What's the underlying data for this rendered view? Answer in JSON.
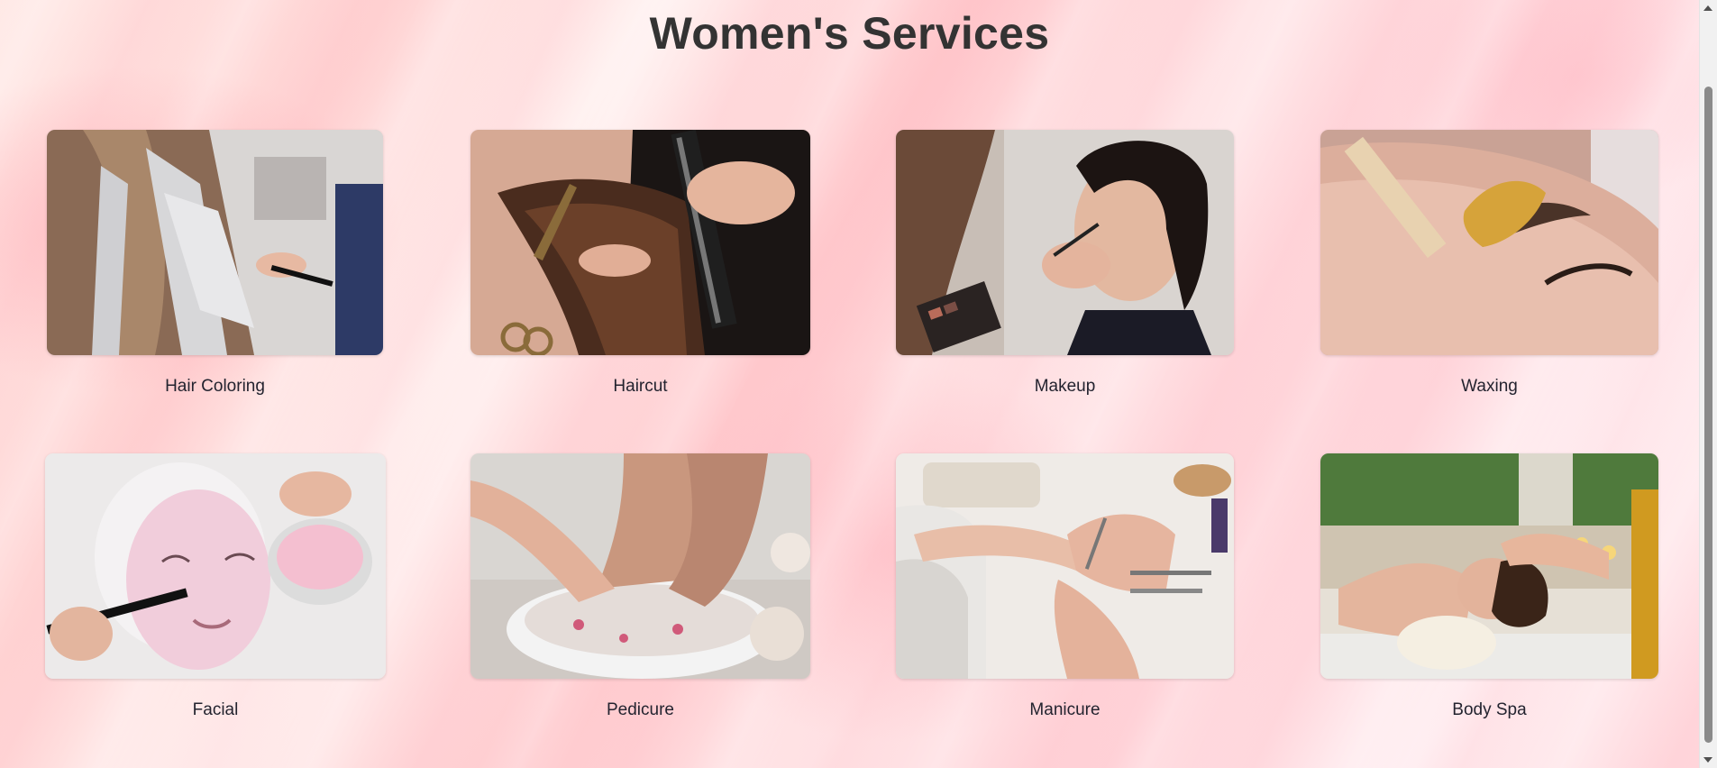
{
  "page": {
    "title": "Women's Services"
  },
  "services": [
    {
      "label": "Hair Coloring",
      "icon": "hair-coloring-photo"
    },
    {
      "label": "Haircut",
      "icon": "haircut-photo"
    },
    {
      "label": "Makeup",
      "icon": "makeup-photo"
    },
    {
      "label": "Waxing",
      "icon": "waxing-photo"
    },
    {
      "label": "Facial",
      "icon": "facial-photo"
    },
    {
      "label": "Pedicure",
      "icon": "pedicure-photo"
    },
    {
      "label": "Manicure",
      "icon": "manicure-photo"
    },
    {
      "label": "Body Spa",
      "icon": "body-spa-photo"
    }
  ],
  "colors": {
    "title": "#333333",
    "label": "#23232f",
    "background_accent": "#ffc8cc"
  }
}
